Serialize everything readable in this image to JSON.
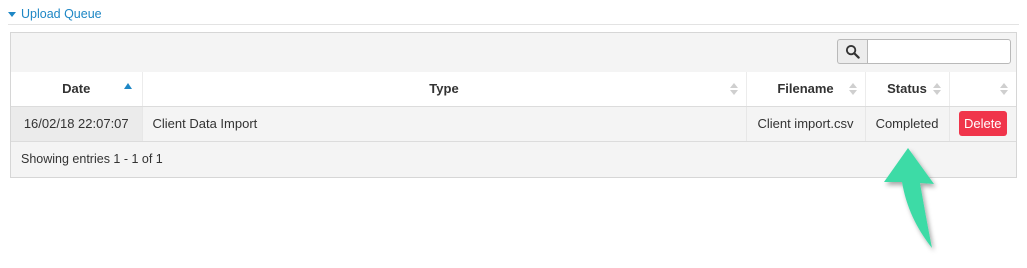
{
  "section": {
    "title": "Upload Queue"
  },
  "search": {
    "placeholder": "",
    "value": ""
  },
  "table": {
    "columns": [
      {
        "label": "Date",
        "sort": "asc"
      },
      {
        "label": "Type",
        "sort": "none"
      },
      {
        "label": "Filename",
        "sort": "none"
      },
      {
        "label": "Status",
        "sort": "none"
      },
      {
        "label": "",
        "sort": "none"
      }
    ],
    "rows": [
      {
        "date": "16/02/18 22:07:07",
        "type": "Client Data Import",
        "filename": "Client import.csv",
        "status": "Completed",
        "action": "Delete"
      }
    ]
  },
  "footer": {
    "text": "Showing entries 1 - 1 of 1"
  },
  "colors": {
    "accent": "#1e87c5",
    "danger": "#f0354b",
    "annotation_arrow": "#3ddba6"
  },
  "icons": {
    "toggle": "caret-down-icon",
    "search": "search-icon",
    "sort": "sort-icon",
    "sorted": "sort-ascending-icon",
    "annotation": "arrow-up-icon"
  }
}
